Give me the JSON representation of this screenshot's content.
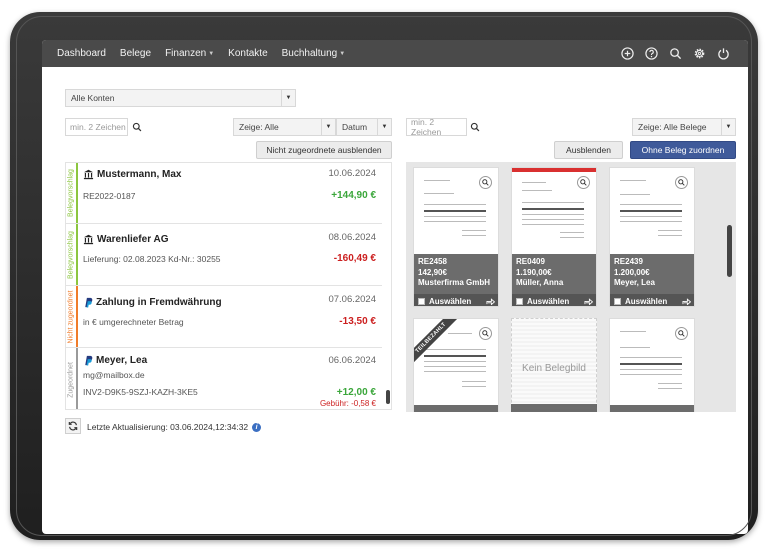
{
  "nav": {
    "items": [
      {
        "label": "Dashboard",
        "dropdown": false
      },
      {
        "label": "Belege",
        "dropdown": false
      },
      {
        "label": "Finanzen",
        "dropdown": true
      },
      {
        "label": "Kontakte",
        "dropdown": false
      },
      {
        "label": "Buchhaltung",
        "dropdown": true
      }
    ],
    "icons": [
      "plus-circle-icon",
      "help-circle-icon",
      "search-icon",
      "gear-icon",
      "power-icon"
    ]
  },
  "left": {
    "account_select": "Alle Konten",
    "search_placeholder": "min. 2 Zeichen",
    "filter_select": "Zeige: Alle",
    "sort_select": "Datum",
    "hide_button": "Nicht zugeordnete ausblenden",
    "transactions": [
      {
        "status": "Belegvorschlag",
        "status_color": "#8cc63f",
        "source": "bank",
        "title": "Mustermann, Max",
        "date": "10.06.2024",
        "sub1": "",
        "sub2": "RE2022-0187",
        "amount": "+144,90 €",
        "sign": "pos",
        "fee": ""
      },
      {
        "status": "Belegvorschlag",
        "status_color": "#8cc63f",
        "source": "bank",
        "title": "Warenliefer AG",
        "date": "08.06.2024",
        "sub1": "",
        "sub2": "Lieferung: 02.08.2023 Kd-Nr.: 30255",
        "amount": "-160,49 €",
        "sign": "neg",
        "fee": ""
      },
      {
        "status": "Nicht zugeordnet",
        "status_color": "#f07c2a",
        "source": "paypal",
        "title": "Zahlung in Fremdwährung",
        "date": "07.06.2024",
        "sub1": "",
        "sub2": "in € umgerechneter Betrag",
        "amount": "-13,50 €",
        "sign": "neg",
        "fee": ""
      },
      {
        "status": "Zugeordnet",
        "status_color": "#9a9a9a",
        "source": "paypal",
        "title": "Meyer, Lea",
        "date": "06.06.2024",
        "sub1": "mg@mailbox.de",
        "sub2": "INV2-D9K5-9SZJ-KAZH-3KE5",
        "amount": "+12,00 €",
        "sign": "pos",
        "fee": "Gebühr: -0,58 €"
      }
    ],
    "last_update": "Letzte Aktualisierung: 03.06.2024,12:34:32"
  },
  "right": {
    "search_placeholder": "min. 2 Zeichen",
    "filter_select": "Zeige: Alle Belege",
    "hide_button": "Ausblenden",
    "assign_button": "Ohne Beleg zuordnen",
    "select_label": "Auswählen",
    "cards_row1": [
      {
        "number": "RE2458",
        "amount": "142,90€",
        "name": "Musterfirma GmbH",
        "red_top": false
      },
      {
        "number": "RE0409",
        "amount": "1.190,00€",
        "name": "Müller, Anna",
        "red_top": true
      },
      {
        "number": "RE2439",
        "amount": "1.200,00€",
        "name": "Meyer, Lea",
        "red_top": false
      }
    ],
    "cards_row2": [
      {
        "sash": "TEILBEZAHLT",
        "placeholder": ""
      },
      {
        "sash": "",
        "placeholder": "Kein Belegbild"
      },
      {
        "sash": "",
        "placeholder": ""
      }
    ]
  }
}
